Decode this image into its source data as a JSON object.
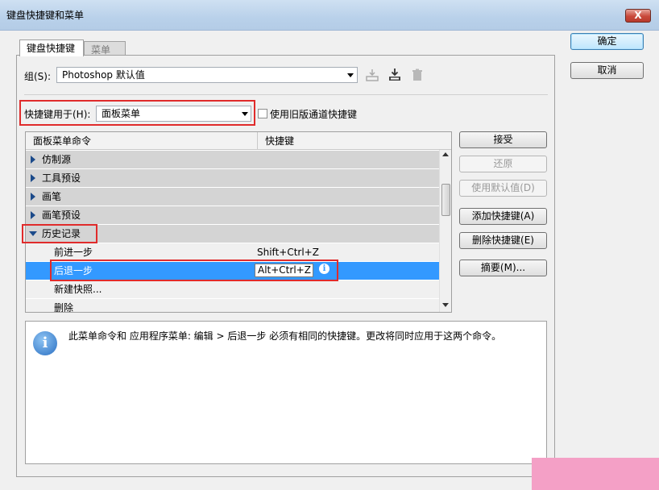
{
  "window": {
    "title": "键盘快捷键和菜单",
    "close_label": "X"
  },
  "tabs": [
    {
      "label": "键盘快捷键"
    },
    {
      "label": "菜单"
    }
  ],
  "set_row": {
    "label": "组(S):",
    "value": "Photoshop 默认值"
  },
  "shortcuts_for": {
    "label": "快捷键用于(H):",
    "value": "面板菜单"
  },
  "legacy_checkbox": {
    "label": "使用旧版通道快捷键",
    "checked": false
  },
  "table": {
    "col_command": "面板菜单命令",
    "col_shortcut": "快捷键",
    "groups": [
      {
        "label": "仿制源"
      },
      {
        "label": "工具预设"
      },
      {
        "label": "画笔"
      },
      {
        "label": "画笔预设"
      }
    ],
    "expanded_group": {
      "label": "历史记录"
    },
    "children": [
      {
        "label": "前进一步",
        "shortcut": "Shift+Ctrl+Z"
      },
      {
        "label": "后退一步",
        "shortcut": "Alt+Ctrl+Z"
      },
      {
        "label": "新建快照...",
        "shortcut": ""
      },
      {
        "label": "删除",
        "shortcut": ""
      }
    ]
  },
  "side_buttons": {
    "accept": "接受",
    "undo": "还原",
    "use_default": "使用默认值(D)",
    "add_shortcut": "添加快捷键(A)",
    "delete_shortcut": "删除快捷键(E)",
    "summarize": "摘要(M)..."
  },
  "dialog_buttons": {
    "ok": "确定",
    "cancel": "取消"
  },
  "info": {
    "icon_glyph": "i",
    "message": "此菜单命令和 应用程序菜单: 编辑 > 后退一步 必须有相同的快捷键。更改将同时应用于这两个命令。"
  },
  "colors": {
    "highlight": "#3399ff",
    "annotation": "#e02b2b"
  }
}
